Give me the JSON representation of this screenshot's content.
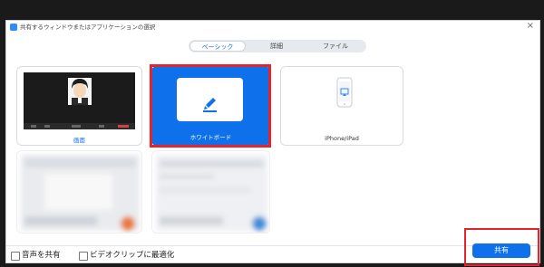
{
  "dialog": {
    "title": "共有するウィンドウまたはアプリケーションの選択",
    "close_glyph": "×"
  },
  "tabs": [
    {
      "label": "ベーシック",
      "active": true
    },
    {
      "label": "詳細",
      "active": false
    },
    {
      "label": "ファイル",
      "active": false
    }
  ],
  "tiles": {
    "screen": {
      "label": "画面"
    },
    "whiteboard": {
      "label": "ホワイトボード"
    },
    "iphone": {
      "label": "iPhone/iPad"
    }
  },
  "bottom": {
    "share_audio_label": "音声を共有",
    "optimize_video_label": "ビデオクリップに最適化",
    "share_button_label": "共有"
  },
  "colors": {
    "accent": "#0e71eb",
    "highlight": "#e6232a"
  }
}
